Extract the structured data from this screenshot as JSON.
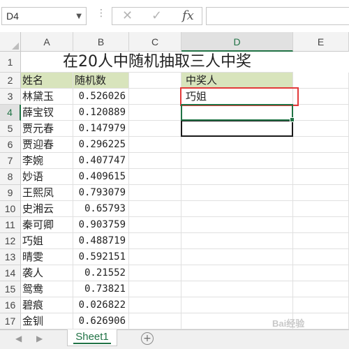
{
  "formula_bar": {
    "name_box": "D4",
    "cancel_icon": "✕",
    "enter_icon": "✓",
    "fx_label": "fx",
    "formula": ""
  },
  "columns": [
    "A",
    "B",
    "C",
    "D",
    "E"
  ],
  "rows": [
    "1",
    "2",
    "3",
    "4",
    "5",
    "6",
    "7",
    "8",
    "9",
    "10",
    "11",
    "12",
    "13",
    "14",
    "15",
    "16",
    "17"
  ],
  "title": "在20人中随机抽取三人中奖",
  "headers": {
    "name": "姓名",
    "rand": "随机数",
    "winner": "中奖人"
  },
  "data": [
    {
      "name": "林黛玉",
      "rand": "0.526026"
    },
    {
      "name": "薛宝钗",
      "rand": "0.120889"
    },
    {
      "name": "贾元春",
      "rand": "0.147979"
    },
    {
      "name": "贾迎春",
      "rand": "0.296225"
    },
    {
      "name": "李婉",
      "rand": "0.407747"
    },
    {
      "name": "妙语",
      "rand": "0.409615"
    },
    {
      "name": "王熙凤",
      "rand": "0.793079"
    },
    {
      "name": "史湘云",
      "rand": "0.65793"
    },
    {
      "name": "秦可卿",
      "rand": "0.903759"
    },
    {
      "name": "巧姐",
      "rand": "0.488719"
    },
    {
      "name": "晴雯",
      "rand": "0.592151"
    },
    {
      "name": "袭人",
      "rand": "0.21552"
    },
    {
      "name": "鸳鸯",
      "rand": "0.73821"
    },
    {
      "name": "碧痕",
      "rand": "0.026822"
    },
    {
      "name": "金钏",
      "rand": "0.626906"
    }
  ],
  "winners": [
    "巧姐",
    "",
    ""
  ],
  "sheet_tab": "Sheet1",
  "add_sheet": "+",
  "nav_prev": "◀",
  "nav_next": "▶",
  "watermark": "Bai经验",
  "colors": {
    "accent": "#217346",
    "header_fill": "#d8e4bc",
    "highlight": "#e23a3a"
  }
}
